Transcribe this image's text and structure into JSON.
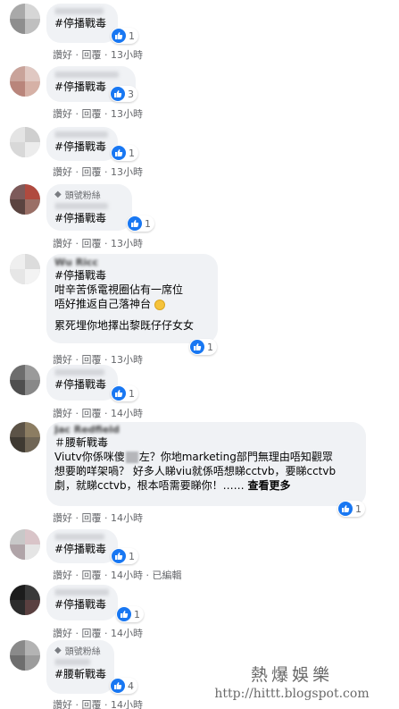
{
  "colors": {
    "bubble": "#f0f2f5",
    "like": "#1877f2",
    "meta": "#65676b",
    "text": "#050505"
  },
  "icons": {
    "reaction": "thumbs-up-icon",
    "badge": "diamond-icon",
    "timer": "clock-emoji-icon"
  },
  "comments": [
    {
      "name": "",
      "text": "#停播戰毒",
      "likes": "1",
      "actions": "讚好 · 回覆 · 13小時"
    },
    {
      "name": "",
      "text": "#停播戰毒",
      "likes": "3",
      "actions": "讚好 · 回覆 · 13小時"
    },
    {
      "name": "",
      "text": "#停播戰毒",
      "likes": "1",
      "actions": "讚好 · 回覆 · 13小時"
    },
    {
      "badge": "頭號粉絲",
      "name": "",
      "text": "#停播戰毒",
      "likes": "1",
      "actions": "讚好 · 回覆 · 13小時"
    },
    {
      "name": "Wu Ricc",
      "lines": [
        "#停播戰毒",
        "咁辛苦係電視圈佔有一席位",
        "唔好推返自己落神台",
        "",
        "累死埋你地擇出黎既仔仔女女"
      ],
      "likes": "1",
      "actions": "讚好 · 回覆 · 13小時"
    },
    {
      "name": "",
      "text": "#停播戰毒",
      "likes": "1",
      "actions": "讚好 · 回覆 · 14小時"
    },
    {
      "name": "Jac Redfield",
      "lines": [
        "＃腰斬戰毒",
        "Viutv你係咪傻",
        "左？你地marketing部門無理由唔知觀眾",
        "想要啲咩架喎？ 好多人睇viu就係唔想睇cctvb，要睇cctvb",
        "劇，就睇cctvb，根本唔需要睇你！……"
      ],
      "see_more": "查看更多",
      "likes": "1",
      "actions": "讚好 · 回覆 · 14小時"
    },
    {
      "name": "",
      "text": "#停播戰毒",
      "likes": "1",
      "actions": "讚好 · 回覆 · 14小時 · 已編輯"
    },
    {
      "name": "",
      "text": "#停播戰毒",
      "likes": "1",
      "actions": "讚好 · 回覆 · 14小時"
    },
    {
      "badge": "頭號粉絲",
      "name": "",
      "text": "#腰斬戰毒",
      "likes": "4",
      "actions": "讚好 · 回覆 · 14小時"
    }
  ],
  "watermark": {
    "title": "熱爆娛樂",
    "url": "http://hittt.blogspot.com"
  }
}
